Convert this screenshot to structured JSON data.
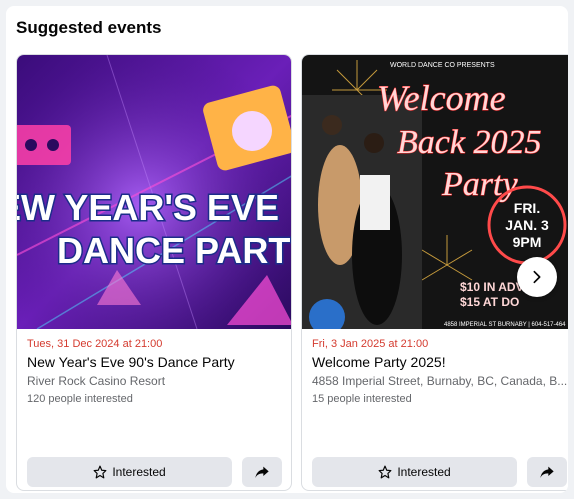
{
  "section": {
    "title": "Suggested events"
  },
  "events": [
    {
      "image": {
        "headline_line1": "EW YEAR'S EVE",
        "headline_line2": "DANCE PART"
      },
      "date": "Tues, 31 Dec 2024 at 21:00",
      "title": "New Year's Eve 90's Dance Party",
      "location": "River Rock Casino Resort",
      "interested": "120 people interested",
      "interested_label": "Interested"
    },
    {
      "image": {
        "banner": "WORLD DANCE CO PRESENTS",
        "headline_line1": "Welcome",
        "headline_line2": "Back 2025",
        "headline_line3": "Party",
        "badge_line1": "FRI.",
        "badge_line2": "JAN. 3",
        "badge_line3": "9PM",
        "price_line1": "$10 IN ADV",
        "price_line2": "$15 AT DO",
        "footer": "4858 IMPERIAL ST BURNABY | 604-517-464"
      },
      "date": "Fri, 3 Jan 2025 at 21:00",
      "title": "Welcome Party 2025!",
      "location": "4858 Imperial Street, Burnaby, BC, Canada, B...",
      "interested": "15 people interested",
      "interested_label": "Interested"
    }
  ],
  "icons": {
    "star": "star-outline-icon",
    "share": "share-arrow-icon",
    "next": "chevron-right-icon"
  },
  "colors": {
    "date_red": "#d43b2f",
    "button_gray": "#e4e6eb"
  }
}
